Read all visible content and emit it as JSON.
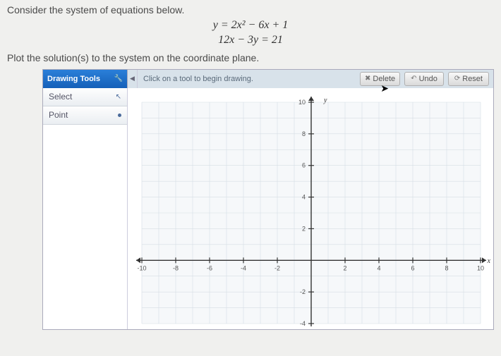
{
  "problem": {
    "intro": "Consider the system of equations below.",
    "eq1": "y = 2x² − 6x + 1",
    "eq2": "12x − 3y = 21",
    "instruction": "Plot the solution(s) to the system on the coordinate plane."
  },
  "toolbar": {
    "title": "Drawing Tools",
    "hint": "Click on a tool to begin drawing.",
    "delete_label": "Delete",
    "undo_label": "Undo",
    "reset_label": "Reset"
  },
  "tools": {
    "select": "Select",
    "point": "Point"
  },
  "chart_data": {
    "type": "scatter",
    "title": "",
    "xlabel": "x",
    "ylabel": "y",
    "xlim": [
      -10,
      10
    ],
    "ylim": [
      -4,
      10
    ],
    "xticks": [
      -10,
      -8,
      -6,
      -4,
      -2,
      2,
      4,
      6,
      8,
      10
    ],
    "yticks": [
      -4,
      -2,
      2,
      4,
      6,
      8,
      10
    ],
    "series": [
      {
        "name": "plotted points",
        "values": []
      }
    ],
    "grid": true
  }
}
